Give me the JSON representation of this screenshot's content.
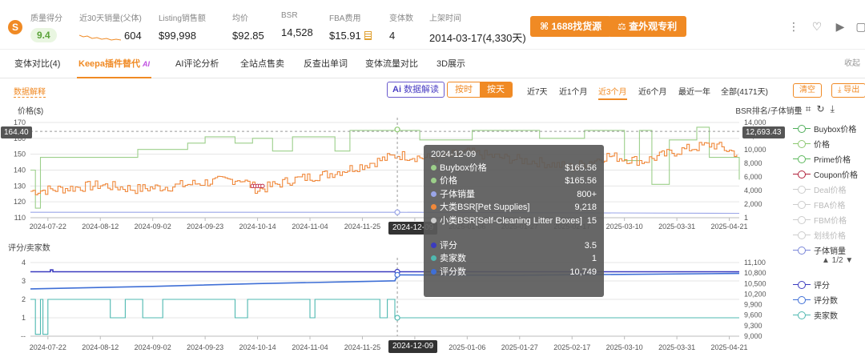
{
  "header": {
    "metrics": [
      {
        "label": "质量得分",
        "value": "9.4"
      },
      {
        "label": "近30天销量(父体)",
        "value": "604"
      },
      {
        "label": "Listing销售额",
        "value": "$99,998"
      },
      {
        "label": "均价",
        "value": "$92.85"
      },
      {
        "label": "BSR",
        "value": "14,528"
      },
      {
        "label": "FBA费用",
        "value": "$15.91"
      },
      {
        "label": "变体数",
        "value": "4"
      },
      {
        "label": "上架时间",
        "value": "2014-03-17(4,330天)"
      }
    ],
    "btn_1688": "1688找货源",
    "btn_patent": "查外观专利",
    "icons": [
      "more-icon",
      "heart-icon",
      "video-icon",
      "bookmark-icon"
    ]
  },
  "tabs": [
    {
      "label": "变体对比(4)",
      "active": false
    },
    {
      "label": "Keepa插件替代",
      "active": true,
      "tag": "AI"
    },
    {
      "label": "AI评论分析",
      "active": false
    },
    {
      "label": "全站点售卖",
      "active": false
    },
    {
      "label": "反查出单词",
      "active": false
    },
    {
      "label": "变体流量对比",
      "active": false
    },
    {
      "label": "3D展示",
      "active": false
    }
  ],
  "collapse_label": "收起",
  "toolbar": {
    "data_explain": "数据解释",
    "ai_button": "数据解读",
    "ai_prefix": "Ai",
    "granularity": [
      "按时",
      "按天"
    ],
    "granularity_active": 1,
    "ranges": [
      "近7天",
      "近1个月",
      "近3个月",
      "近6个月",
      "最近一年",
      "全部(4171天)"
    ],
    "range_active": 2,
    "clear": "清空",
    "export": "导出"
  },
  "chart_data": [
    {
      "type": "line",
      "title": "",
      "ylabel": "价格($)",
      "y2label": "BSR排名/子体销量",
      "ylim": [
        110,
        170
      ],
      "y_ticks": [
        110,
        120,
        130,
        140,
        150,
        160,
        170
      ],
      "y2lim": [
        0,
        14000
      ],
      "y2_ticks": [
        "1",
        "2,000",
        "4,000",
        "6,000",
        "8,000",
        "10,000",
        "12,000",
        "14,000"
      ],
      "x_ticks": [
        "2024-07-22",
        "2024-08-12",
        "2024-09-02",
        "2024-09-23",
        "2024-10-14",
        "2024-11-04",
        "2024-11-25",
        "2024-12-16",
        "2025-01-06",
        "2025-01-27",
        "2025-02-17",
        "2025-03-10",
        "2025-03-31",
        "2025-04-21"
      ],
      "xlim": [
        "2024-07-15",
        "2025-04-25"
      ],
      "left_readout": "164.40",
      "right_readout": "12,693.43",
      "series": [
        {
          "name": "Buybox价格",
          "color": "#9ccf8a",
          "axis": "left",
          "points": [
            [
              "2024-07-15",
              140
            ],
            [
              "2024-07-17",
              116
            ],
            [
              "2024-07-19",
              148
            ],
            [
              "2024-08-20",
              148
            ],
            [
              "2024-08-27",
              153
            ],
            [
              "2024-09-16",
              157
            ],
            [
              "2024-09-23",
              161
            ],
            [
              "2024-10-05",
              157
            ],
            [
              "2024-10-12",
              160
            ],
            [
              "2024-10-20",
              152
            ],
            [
              "2024-10-28",
              161
            ],
            [
              "2024-11-14",
              152
            ],
            [
              "2024-11-20",
              165
            ],
            [
              "2024-12-18",
              159
            ],
            [
              "2025-01-08",
              165
            ],
            [
              "2025-02-04",
              160
            ],
            [
              "2025-02-22",
              165
            ],
            [
              "2025-03-10",
              146
            ],
            [
              "2025-03-16",
              165
            ],
            [
              "2025-03-21",
              131
            ],
            [
              "2025-03-28",
              159
            ],
            [
              "2025-04-08",
              167
            ],
            [
              "2025-04-13",
              148
            ],
            [
              "2025-04-25",
              134
            ]
          ]
        },
        {
          "name": "价格",
          "color": "#9ccf8a",
          "axis": "left",
          "hidden_line": true,
          "points": [
            [
              "2024-07-15",
              140
            ]
          ]
        },
        {
          "name": "大类BSR[Pet Supplies]",
          "color": "#f0883a",
          "axis": "right",
          "points": [
            [
              "2024-07-15",
              3900
            ],
            [
              "2024-07-29",
              4300
            ],
            [
              "2024-08-12",
              4800
            ],
            [
              "2024-08-26",
              4200
            ],
            [
              "2024-09-09",
              4600
            ],
            [
              "2024-09-23",
              5200
            ],
            [
              "2024-10-07",
              5700
            ],
            [
              "2024-10-14",
              4100
            ],
            [
              "2024-10-28",
              5600
            ],
            [
              "2024-11-11",
              6400
            ],
            [
              "2024-11-25",
              7700
            ],
            [
              "2024-12-09",
              9218
            ],
            [
              "2024-12-23",
              8700
            ],
            [
              "2025-01-06",
              9600
            ],
            [
              "2025-01-20",
              8800
            ],
            [
              "2025-02-03",
              8200
            ],
            [
              "2025-02-17",
              7400
            ],
            [
              "2025-03-03",
              9100
            ],
            [
              "2025-03-17",
              8300
            ],
            [
              "2025-03-31",
              9800
            ],
            [
              "2025-04-14",
              10800
            ],
            [
              "2025-04-25",
              9300
            ]
          ]
        },
        {
          "name": "小类BSR[Self-Cleaning Litter Boxes]",
          "color": "#cccccc",
          "axis": "right",
          "hidden_line": true,
          "points": [
            [
              "2024-07-15",
              15
            ]
          ]
        },
        {
          "name": "子体销量",
          "color": "#9aa5e8",
          "axis": "right",
          "points": [
            [
              "2024-07-15",
              800
            ],
            [
              "2024-12-09",
              800
            ],
            [
              "2025-04-25",
              650
            ]
          ]
        }
      ],
      "coupon_markers": {
        "color": "#c0304a",
        "dates": [
          "2024-10-12",
          "2024-10-13",
          "2024-10-14",
          "2024-10-15",
          "2024-10-16"
        ],
        "value": 130
      }
    },
    {
      "type": "line",
      "title": "",
      "ylabel": "评分/卖家数",
      "ylim": [
        0,
        4
      ],
      "y_ticks": [
        "--",
        "1",
        "2",
        "3",
        "4"
      ],
      "y2lim": [
        9000,
        11100
      ],
      "y2_ticks": [
        "9,000",
        "9,300",
        "9,600",
        "9,900",
        "10,200",
        "10,500",
        "10,800",
        "11,100"
      ],
      "x_ticks": [
        "2024-07-22",
        "2024-08-12",
        "2024-09-02",
        "2024-09-23",
        "2024-10-14",
        "2024-11-04",
        "2024-11-25",
        "2024-12-16",
        "2025-01-06",
        "2025-01-27",
        "2025-02-17",
        "2025-03-10",
        "2025-03-31",
        "2025-04-21"
      ],
      "xlim": [
        "2024-07-15",
        "2025-04-25"
      ],
      "series": [
        {
          "name": "评分",
          "color": "#3b3bbf",
          "axis": "left",
          "points": [
            [
              "2024-07-15",
              3.5
            ],
            [
              "2024-07-22",
              3.5
            ],
            [
              "2024-07-23",
              3.6
            ],
            [
              "2024-07-24",
              3.5
            ],
            [
              "2025-04-25",
              3.5
            ]
          ]
        },
        {
          "name": "评分数",
          "color": "#3f6fd6",
          "axis": "right",
          "points": [
            [
              "2024-07-15",
              10350
            ],
            [
              "2024-09-02",
              10420
            ],
            [
              "2024-10-14",
              10500
            ],
            [
              "2024-11-25",
              10560
            ],
            [
              "2024-12-08",
              10580
            ],
            [
              "2024-12-09",
              10749
            ],
            [
              "2025-01-27",
              10740
            ],
            [
              "2025-04-25",
              10790
            ]
          ]
        },
        {
          "name": "卖家数",
          "color": "#4fb8b0",
          "axis": "left",
          "points": [
            [
              "2024-07-15",
              2
            ],
            [
              "2024-07-17",
              2
            ],
            [
              "2024-07-17",
              0.1
            ],
            [
              "2024-07-19",
              0.1
            ],
            [
              "2024-07-19",
              2
            ],
            [
              "2024-07-20",
              2
            ],
            [
              "2024-07-20",
              0.1
            ],
            [
              "2024-07-22",
              0.1
            ],
            [
              "2024-07-22",
              2
            ],
            [
              "2024-08-16",
              2
            ],
            [
              "2024-08-16",
              1
            ],
            [
              "2024-08-22",
              1
            ],
            [
              "2024-08-22",
              2
            ],
            [
              "2024-08-29",
              2
            ],
            [
              "2024-08-29",
              1
            ],
            [
              "2024-09-06",
              1
            ],
            [
              "2024-09-06",
              2
            ],
            [
              "2024-10-05",
              2
            ],
            [
              "2024-10-05",
              1
            ],
            [
              "2024-10-10",
              1
            ],
            [
              "2024-10-10",
              2
            ],
            [
              "2024-11-04",
              2
            ],
            [
              "2024-11-04",
              1
            ],
            [
              "2024-11-06",
              1
            ],
            [
              "2024-11-06",
              2
            ],
            [
              "2024-12-02",
              2
            ],
            [
              "2024-12-02",
              1
            ],
            [
              "2024-12-05",
              1
            ],
            [
              "2024-12-05",
              2
            ],
            [
              "2024-12-08",
              2
            ],
            [
              "2024-12-08",
              1
            ],
            [
              "2025-04-25",
              1
            ]
          ]
        }
      ]
    }
  ],
  "tooltip": {
    "date": "2024-12-09",
    "rows": [
      {
        "label": "Buybox价格",
        "value": "$165.56",
        "color": "#9ccf8a"
      },
      {
        "label": "价格",
        "value": "$165.56",
        "color": "#9ccf8a"
      },
      {
        "label": "子体销量",
        "value": "800+",
        "color": "#9aa5e8"
      },
      {
        "label": "大类BSR[Pet Supplies]",
        "value": "9,218",
        "color": "#f0883a"
      },
      {
        "label": "小类BSR[Self-Cleaning Litter Boxes]",
        "value": "15",
        "color": "#cccccc"
      }
    ],
    "rows2": [
      {
        "label": "评分",
        "value": "3.5",
        "color": "#3b3bbf"
      },
      {
        "label": "卖家数",
        "value": "1",
        "color": "#4fb8b0"
      },
      {
        "label": "评分数",
        "value": "10,749",
        "color": "#3f6fd6"
      }
    ]
  },
  "crosshair_date": "2024-12-09",
  "legend_top": [
    {
      "label": "Buybox价格",
      "color": "#4fae5a",
      "dim": false
    },
    {
      "label": "价格",
      "color": "#8cc870",
      "dim": false
    },
    {
      "label": "Prime价格",
      "color": "#5cb85c",
      "dim": false
    },
    {
      "label": "Coupon价格",
      "color": "#b0203a",
      "dim": false
    },
    {
      "label": "Deal价格",
      "color": "#cccccc",
      "dim": true
    },
    {
      "label": "FBA价格",
      "color": "#cccccc",
      "dim": true
    },
    {
      "label": "FBM价格",
      "color": "#cccccc",
      "dim": true
    },
    {
      "label": "划线价格",
      "color": "#cccccc",
      "dim": true
    },
    {
      "label": "子体销量",
      "color": "#7a86d8",
      "dim": false
    }
  ],
  "legend_pager": "▲ 1/2 ▼",
  "legend_bottom": [
    {
      "label": "评分",
      "color": "#3b3bbf"
    },
    {
      "label": "评分数",
      "color": "#3f6fd6"
    },
    {
      "label": "卖家数",
      "color": "#4fb8b0"
    }
  ]
}
